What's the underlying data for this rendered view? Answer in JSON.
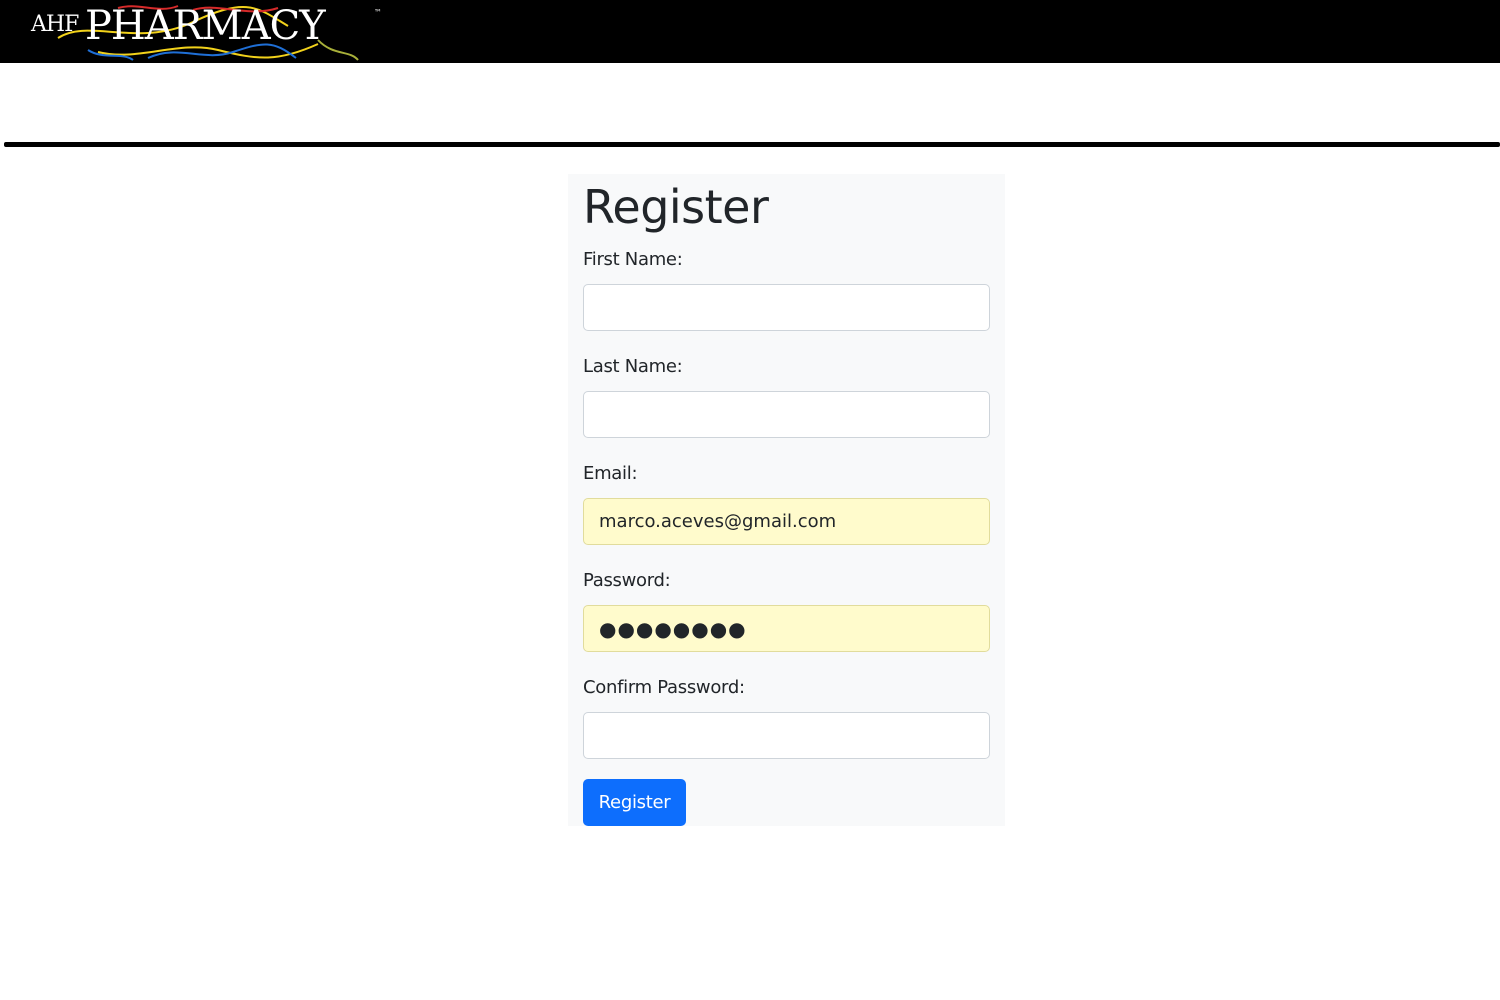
{
  "brand": {
    "prefix": "AHF",
    "name": "PHARMACY",
    "trademark": "™",
    "colors": {
      "header_bg": "#000000",
      "logo_text": "#ffffff",
      "swirl_yellow": "#f2d21b",
      "swirl_blue": "#1f6fd6",
      "swirl_red": "#d62a2a",
      "swirl_olive": "#a8b03a"
    }
  },
  "form": {
    "title": "Register",
    "fields": [
      {
        "label": "First Name:",
        "type": "text",
        "value": ""
      },
      {
        "label": "Last Name:",
        "type": "text",
        "value": ""
      },
      {
        "label": "Email:",
        "type": "email",
        "value": "marco.aceves@gmail.com"
      },
      {
        "label": "Password:",
        "type": "password",
        "value": "●●●●●●●●"
      },
      {
        "label": "Confirm Password:",
        "type": "password",
        "value": ""
      }
    ],
    "submit_label": "Register",
    "colors": {
      "card_bg": "#f8f9fa",
      "autofill_bg": "#fffbcc",
      "button_bg": "#0d6efd"
    }
  }
}
